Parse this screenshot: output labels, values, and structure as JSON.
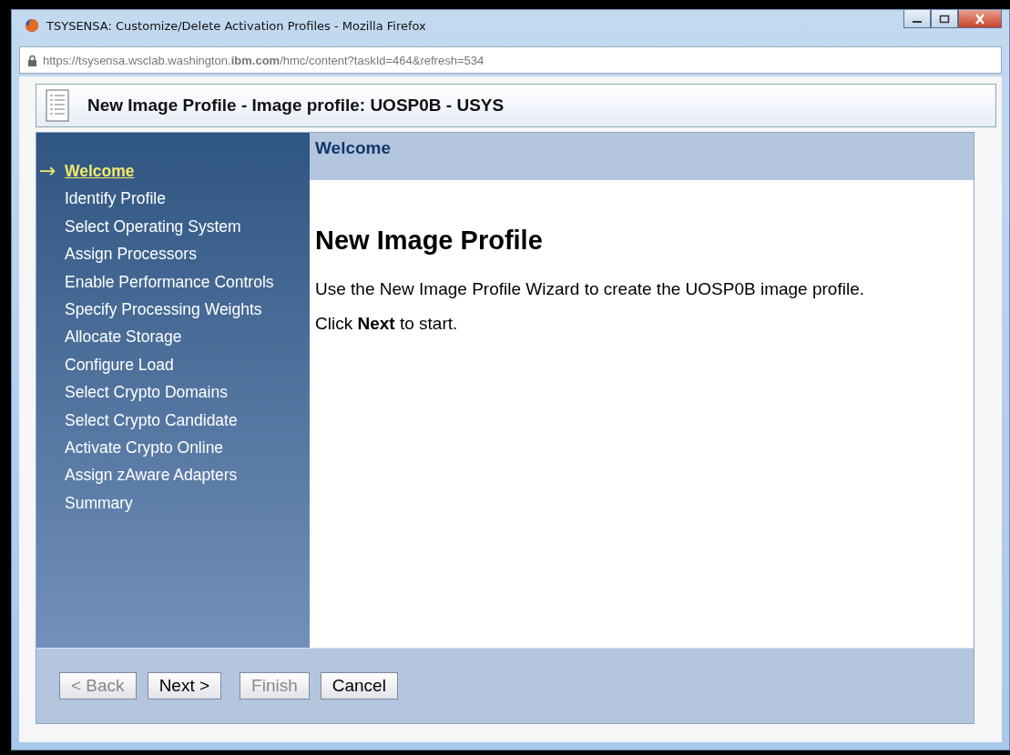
{
  "window": {
    "title": "TSYSENSA: Customize/Delete Activation Profiles - Mozilla Firefox"
  },
  "address_bar": {
    "url": "https://tsysensa.wsclab.washington.**ibm.com**/hmc/content?taskId=464&refresh=534"
  },
  "header": {
    "title": "New Image Profile - Image profile: UOSP0B - USYS"
  },
  "wizard": {
    "steps": [
      {
        "label": "Welcome",
        "selected": true
      },
      {
        "label": "Identify Profile",
        "selected": false
      },
      {
        "label": "Select Operating System",
        "selected": false
      },
      {
        "label": "Assign Processors",
        "selected": false
      },
      {
        "label": "Enable Performance Controls",
        "selected": false
      },
      {
        "label": "Specify Processing Weights",
        "selected": false
      },
      {
        "label": "Allocate Storage",
        "selected": false
      },
      {
        "label": "Configure Load",
        "selected": false
      },
      {
        "label": "Select Crypto Domains",
        "selected": false
      },
      {
        "label": "Select Crypto Candidate",
        "selected": false
      },
      {
        "label": "Activate Crypto Online",
        "selected": false
      },
      {
        "label": "Assign zAware Adapters",
        "selected": false
      },
      {
        "label": "Summary",
        "selected": false
      }
    ],
    "current_marker": "→",
    "page_title": "Welcome",
    "heading": "New Image Profile",
    "paragraphs": [
      "Use the New Image Profile Wizard to create the UOSP0B image profile.",
      "Click **Next** to start."
    ],
    "buttons": [
      {
        "label": "< Back",
        "disabled": true
      },
      {
        "label": "Next >",
        "disabled": false
      },
      {
        "label": "Finish",
        "disabled": true
      },
      {
        "label": "Cancel",
        "disabled": false
      }
    ]
  }
}
